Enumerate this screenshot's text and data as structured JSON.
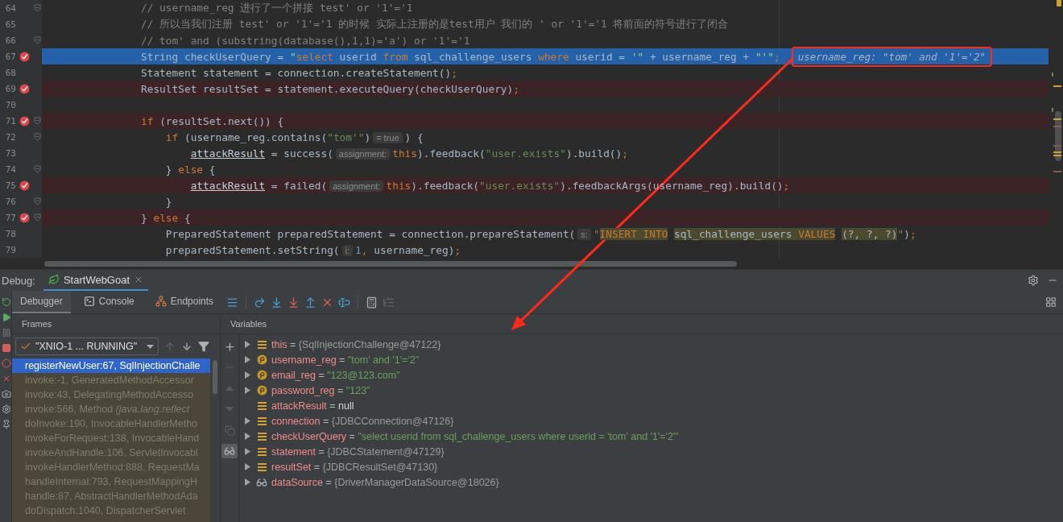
{
  "editor": {
    "lines": [
      {
        "number": "64",
        "breakpoint": false,
        "current": false,
        "fold": true,
        "segments": [
          {
            "kind": "comment",
            "text": "// username_reg 进行了一个拼接 test' or '1'='1"
          }
        ]
      },
      {
        "number": "65",
        "breakpoint": false,
        "current": false,
        "fold": false,
        "segments": [
          {
            "kind": "comment",
            "text": "// 所以当我们注册 test' or '1'='1 的时候 实际上注册的是test用户 我们的 ' or '1'='1 将前面的符号进行了闭合"
          }
        ]
      },
      {
        "number": "66",
        "breakpoint": false,
        "current": false,
        "fold": true,
        "segments": [
          {
            "kind": "comment",
            "text": "// tom' and (substring(database(),1,1)='a') or '1'='1"
          }
        ]
      },
      {
        "number": "67",
        "breakpoint": true,
        "current": true,
        "fold": false,
        "segments": [
          {
            "kind": "text",
            "text": "String checkUserQuery = "
          },
          {
            "kind": "string",
            "text": "\""
          },
          {
            "kind": "keyword",
            "text": "select"
          },
          {
            "kind": "text",
            "text": " userid "
          },
          {
            "kind": "keyword",
            "text": "from"
          },
          {
            "kind": "text",
            "text": " sql_challenge_users "
          },
          {
            "kind": "keyword",
            "text": "where"
          },
          {
            "kind": "text",
            "text": " userid = "
          },
          {
            "kind": "string",
            "text": "'\""
          },
          {
            "kind": "text",
            "text": " + username_reg + "
          },
          {
            "kind": "string",
            "text": "\"'\""
          },
          {
            "kind": "punct",
            "text": ";"
          },
          {
            "kind": "inline-value",
            "text": "username_reg: \"tom' and '1'='2\"",
            "annotated": true
          }
        ]
      },
      {
        "number": "68",
        "breakpoint": false,
        "current": false,
        "fold": false,
        "segments": [
          {
            "kind": "text",
            "text": "Statement statement = connection.createStatement()"
          },
          {
            "kind": "punct",
            "text": ";"
          }
        ]
      },
      {
        "number": "69",
        "breakpoint": true,
        "current": false,
        "fold": false,
        "segments": [
          {
            "kind": "text",
            "text": "ResultSet resultSet = statement.executeQuery(checkUserQuery)"
          },
          {
            "kind": "punct",
            "text": ";"
          }
        ]
      },
      {
        "number": "70",
        "breakpoint": false,
        "current": false,
        "fold": false
      },
      {
        "number": "71",
        "breakpoint": true,
        "current": false,
        "fold": true,
        "segments": [
          {
            "kind": "keyword",
            "text": "if"
          },
          {
            "kind": "text",
            "text": " (resultSet.next()) {"
          }
        ]
      },
      {
        "number": "72",
        "breakpoint": false,
        "current": false,
        "fold": true,
        "segments": [
          {
            "kind": "keyword",
            "text": "    if"
          },
          {
            "kind": "text",
            "text": " (username_reg.contains("
          },
          {
            "kind": "string",
            "text": "\"tom'\""
          },
          {
            "kind": "text",
            "text": ")"
          },
          {
            "kind": "hint",
            "text": "= true"
          },
          {
            "kind": "text",
            "text": ") {"
          }
        ]
      },
      {
        "number": "73",
        "breakpoint": false,
        "current": false,
        "fold": false,
        "segments": [
          {
            "kind": "field",
            "text": "        attackResult"
          },
          {
            "kind": "text",
            "text": " = success("
          },
          {
            "kind": "hint",
            "text": "assignment:"
          },
          {
            "kind": "keyword",
            "text": "this"
          },
          {
            "kind": "text",
            "text": ").feedback("
          },
          {
            "kind": "string",
            "text": "\"user.exists\""
          },
          {
            "kind": "text",
            "text": ").build()"
          },
          {
            "kind": "punct",
            "text": ";"
          }
        ]
      },
      {
        "number": "74",
        "breakpoint": false,
        "current": false,
        "fold": true,
        "segments": [
          {
            "kind": "text",
            "text": "    } "
          },
          {
            "kind": "keyword",
            "text": "else"
          },
          {
            "kind": "text",
            "text": " {"
          }
        ]
      },
      {
        "number": "75",
        "breakpoint": true,
        "current": false,
        "fold": false,
        "segments": [
          {
            "kind": "field",
            "text": "        attackResult"
          },
          {
            "kind": "text",
            "text": " = failed("
          },
          {
            "kind": "hint",
            "text": "assignment:"
          },
          {
            "kind": "keyword",
            "text": "this"
          },
          {
            "kind": "text",
            "text": ").feedback("
          },
          {
            "kind": "string",
            "text": "\"user.exists\""
          },
          {
            "kind": "text",
            "text": ").feedbackArgs(username_reg).build()"
          },
          {
            "kind": "punct",
            "text": ";"
          }
        ]
      },
      {
        "number": "76",
        "breakpoint": false,
        "current": false,
        "fold": true,
        "segments": [
          {
            "kind": "text",
            "text": "    }"
          }
        ]
      },
      {
        "number": "77",
        "breakpoint": true,
        "current": false,
        "fold": true,
        "segments": [
          {
            "kind": "text",
            "text": "} "
          },
          {
            "kind": "keyword",
            "text": "else"
          },
          {
            "kind": "text",
            "text": " {"
          }
        ]
      },
      {
        "number": "78",
        "breakpoint": false,
        "current": false,
        "fold": false,
        "segments": [
          {
            "kind": "text",
            "text": "    PreparedStatement preparedStatement = connection.prepareStatement("
          },
          {
            "kind": "hint",
            "text": "s:"
          },
          {
            "kind": "string",
            "text": "\""
          },
          {
            "kind": "sql-keyword",
            "text": "INSERT INTO"
          },
          {
            "kind": "sql",
            "text": " sql_challenge_users "
          },
          {
            "kind": "sql-keyword",
            "text": "VALUES"
          },
          {
            "kind": "sql",
            "text": " (?, ?, ?)"
          },
          {
            "kind": "string",
            "text": "\""
          },
          {
            "kind": "text",
            "text": ")"
          },
          {
            "kind": "punct",
            "text": ";"
          }
        ]
      },
      {
        "number": "79",
        "breakpoint": false,
        "current": false,
        "fold": false,
        "segments": [
          {
            "kind": "text",
            "text": "    preparedStatement.setString("
          },
          {
            "kind": "hint",
            "text": "i:"
          },
          {
            "kind": "number",
            "text": "1"
          },
          {
            "kind": "punct",
            "text": ","
          },
          {
            "kind": "text",
            "text": " username_reg)"
          },
          {
            "kind": "punct",
            "text": ";"
          }
        ]
      }
    ]
  },
  "debug": {
    "label": "Debug:",
    "run_tab": {
      "label": "StartWebGoat"
    },
    "tabs": [
      {
        "label": "Debugger",
        "kind": "debugger",
        "selected": true
      },
      {
        "label": "Console",
        "kind": "console",
        "selected": false
      },
      {
        "label": "Endpoints",
        "kind": "endpoints",
        "selected": false
      }
    ]
  },
  "frames": {
    "title": "Frames",
    "thread": "\"XNIO-1 ... RUNNING\"",
    "items": [
      {
        "text": "registerNewUser:67, SqlInjectionChalle",
        "selected": true
      },
      {
        "text": "invoke:-1, GeneratedMethodAccessor",
        "selected": false
      },
      {
        "text": "invoke:43, DelegatingMethodAccesso",
        "selected": false
      },
      {
        "text": "invoke:566, Method *(java.lang.reflect*",
        "selected": false
      },
      {
        "text": "doInvoke:190, InvocableHandlerMetho",
        "selected": false
      },
      {
        "text": "invokeForRequest:138, InvocableHand",
        "selected": false
      },
      {
        "text": "invokeAndHandle:106, ServletInvocabl",
        "selected": false
      },
      {
        "text": "invokeHandlerMethod:888, RequestMa",
        "selected": false
      },
      {
        "text": "handleInternal:793, RequestMappingH",
        "selected": false
      },
      {
        "text": "handle:87, AbstractHandlerMethodAda",
        "selected": false
      },
      {
        "text": "doDispatch:1040, DispatcherServlet",
        "selected": false
      }
    ]
  },
  "variables": {
    "title": "Variables",
    "items": [
      {
        "name": "this",
        "equals": "=",
        "value": "{SqlInjectionChallenge@47122}",
        "kind": "field",
        "expandable": true
      },
      {
        "name": "username_reg",
        "equals": "=",
        "value": "\"tom' and '1'='2\"",
        "kind": "parameter",
        "expandable": true
      },
      {
        "name": "email_reg",
        "equals": "=",
        "value": "\"123@123.com\"",
        "kind": "parameter",
        "expandable": true
      },
      {
        "name": "password_reg",
        "equals": "=",
        "value": "\"123\"",
        "kind": "parameter",
        "expandable": true
      },
      {
        "name": "attackResult",
        "equals": "=",
        "value": "null",
        "kind": "field",
        "expandable": false
      },
      {
        "name": "connection",
        "equals": "=",
        "value": "{JDBCConnection@47126}",
        "kind": "field",
        "expandable": true
      },
      {
        "name": "checkUserQuery",
        "equals": "=",
        "value": "\"select userid from sql_challenge_users where userid = 'tom' and '1'='2'\"",
        "kind": "field",
        "expandable": true
      },
      {
        "name": "statement",
        "equals": "=",
        "value": "{JDBCStatement@47129}",
        "kind": "field",
        "expandable": true
      },
      {
        "name": "resultSet",
        "equals": "=",
        "value": "{JDBCResultSet@47130}",
        "kind": "field",
        "expandable": true
      },
      {
        "name": "dataSource",
        "equals": "=",
        "value": "{DriverManagerDataSource@18026}",
        "kind": "watch",
        "expandable": true
      }
    ]
  }
}
